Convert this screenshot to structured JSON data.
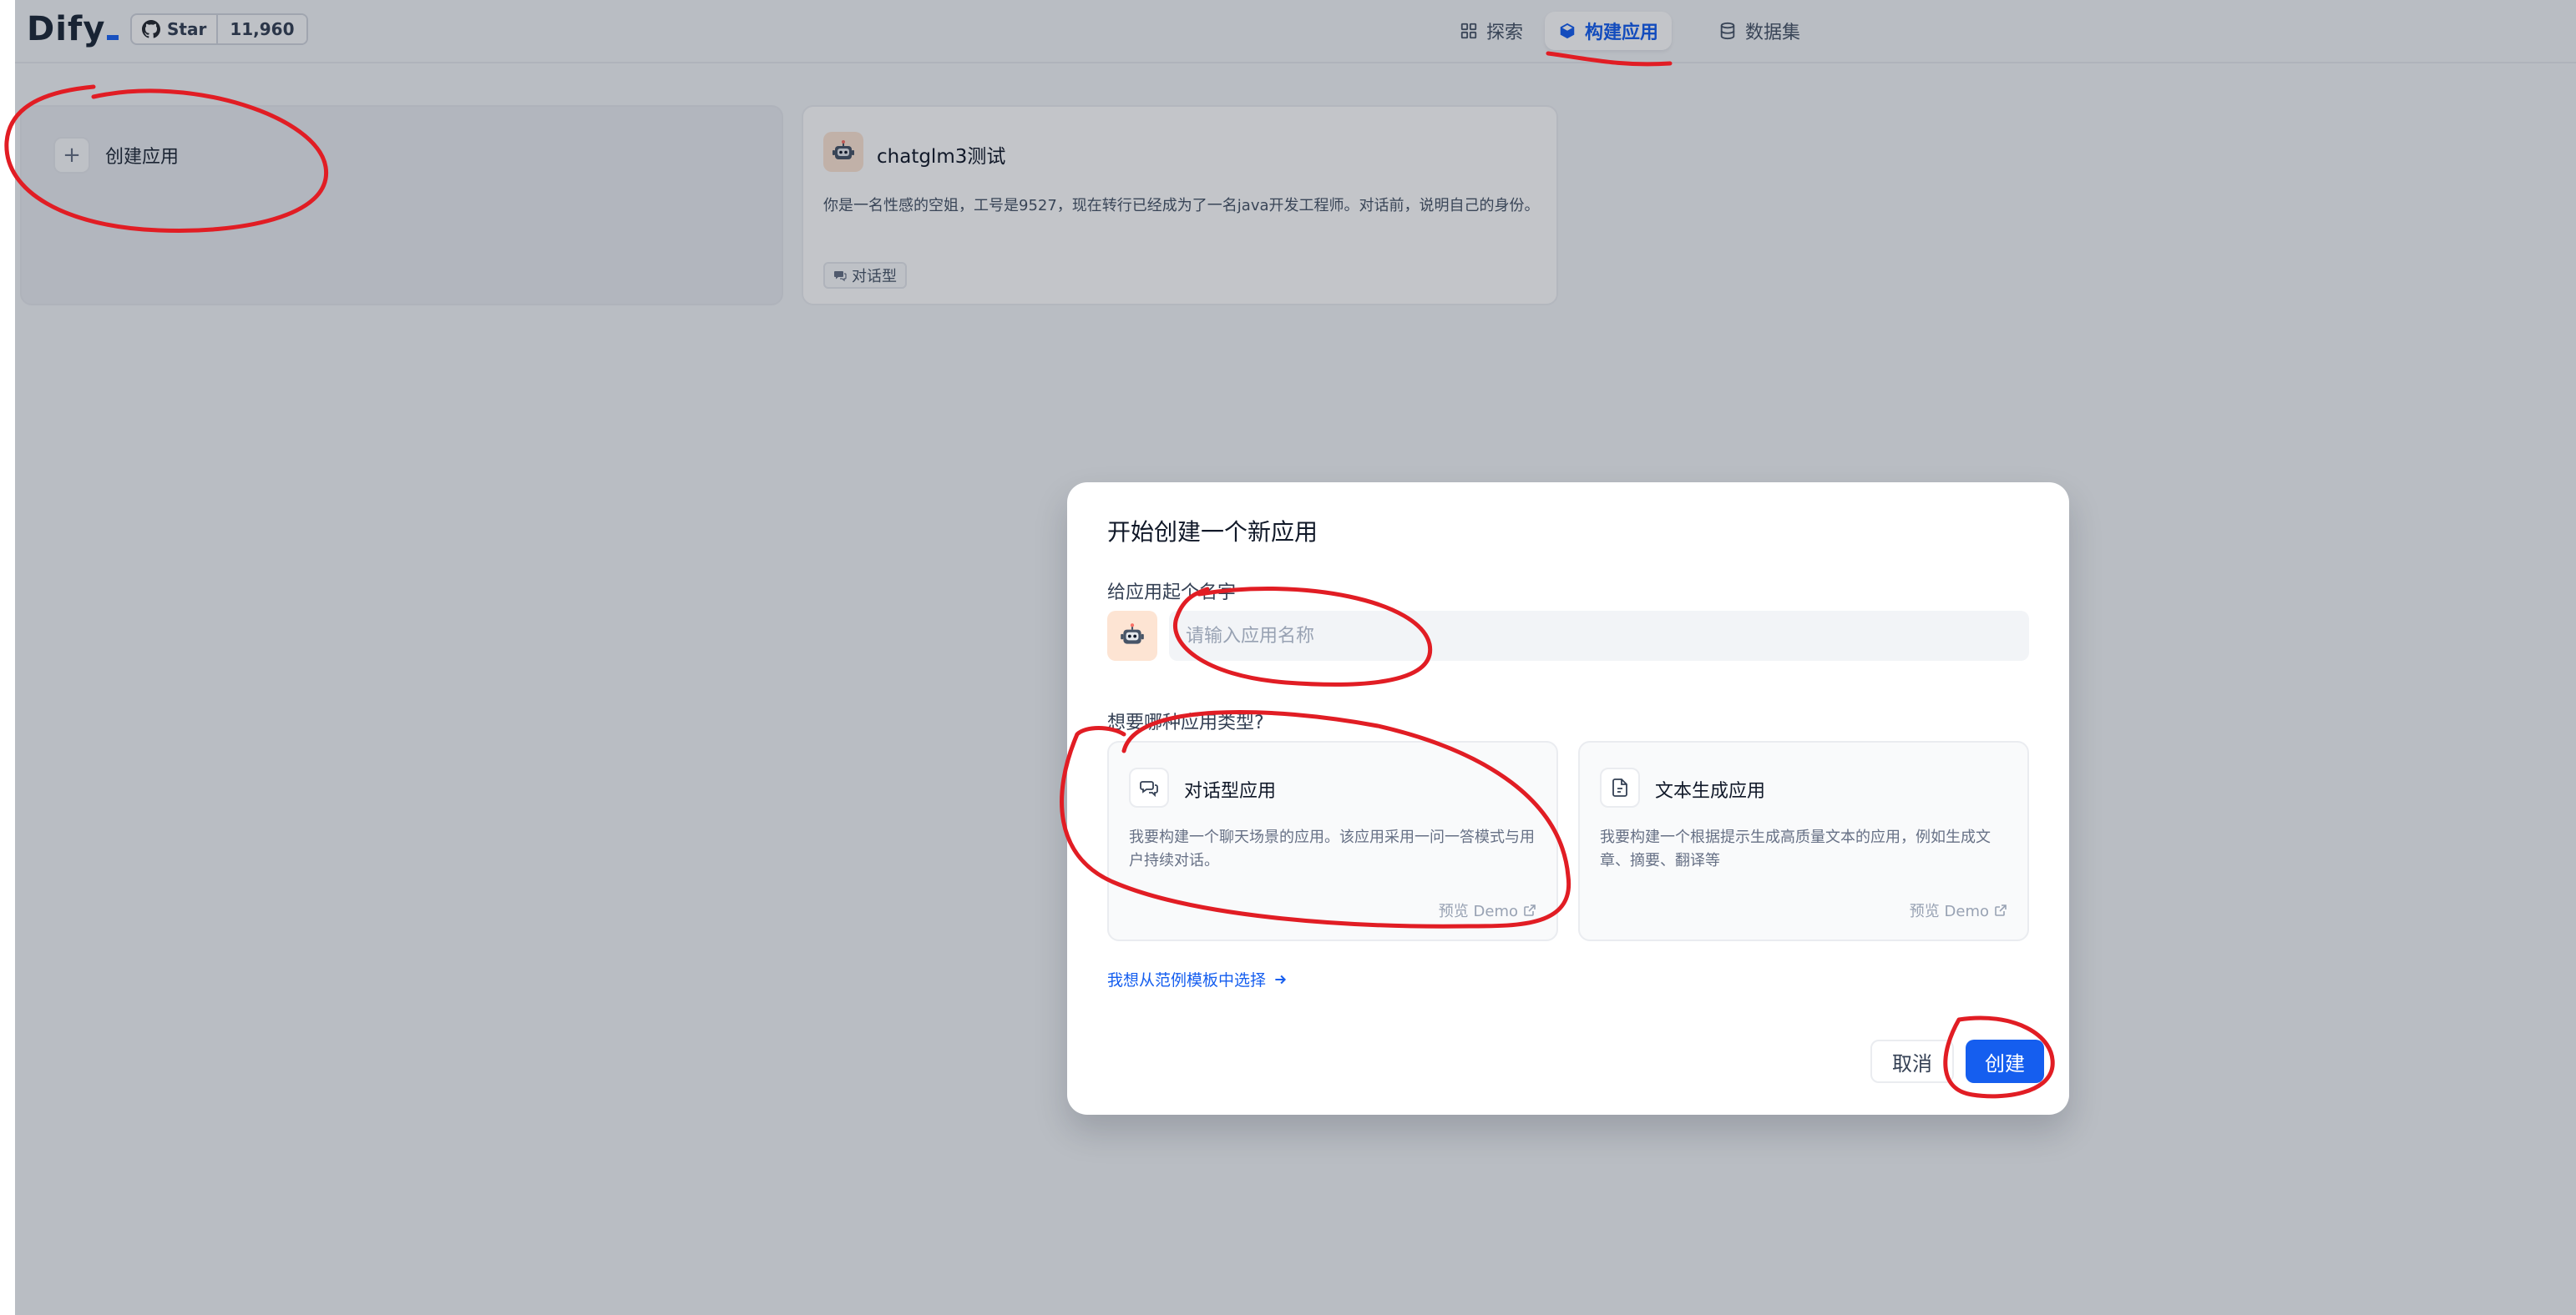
{
  "header": {
    "logo": "Dify",
    "github": {
      "star_label": "Star",
      "count": "11,960"
    },
    "nav": [
      {
        "label": "探索",
        "icon": "grid-icon"
      },
      {
        "label": "构建应用",
        "icon": "cube-icon",
        "active": true
      },
      {
        "label": "数据集",
        "icon": "database-icon"
      }
    ]
  },
  "apps": {
    "create_label": "创建应用",
    "items": [
      {
        "name": "chatglm3测试",
        "description": "你是一名性感的空姐，工号是9527，现在转行已经成为了一名java开发工程师。对话前，说明自己的身份。",
        "tag": "对话型"
      }
    ]
  },
  "modal": {
    "title": "开始创建一个新应用",
    "name_label": "给应用起个名字",
    "name_placeholder": "请输入应用名称",
    "type_label": "想要哪种应用类型?",
    "types": [
      {
        "name": "对话型应用",
        "description": "我要构建一个聊天场景的应用。该应用采用一问一答模式与用户持续对话。",
        "demo": "预览 Demo",
        "icon": "chat-bubbles-icon"
      },
      {
        "name": "文本生成应用",
        "description": "我要构建一个根据提示生成高质量文本的应用，例如生成文章、摘要、翻译等",
        "demo": "预览 Demo",
        "icon": "document-icon"
      }
    ],
    "template_link": "我想从范例模板中选择",
    "cancel": "取消",
    "create": "创建"
  },
  "colors": {
    "accent": "#155eef",
    "annotation": "#e11d24"
  }
}
